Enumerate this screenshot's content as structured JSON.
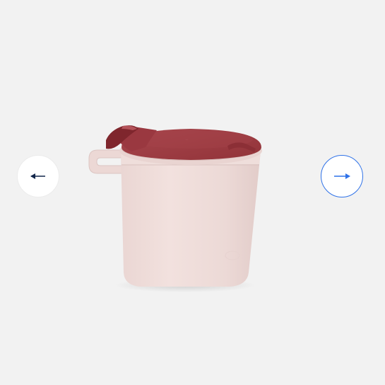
{
  "carousel": {
    "image": {
      "subject": "cup-with-lid"
    },
    "prev_button": {
      "icon": "arrow-left-icon",
      "color": "#12264a"
    },
    "next_button": {
      "icon": "arrow-right-icon",
      "color": "#2f72e8",
      "border_color": "#2f72e8"
    },
    "colors": {
      "background": "#f2f2f2",
      "cup_body": "#efdcd9",
      "lid": "#9d3b43"
    }
  }
}
